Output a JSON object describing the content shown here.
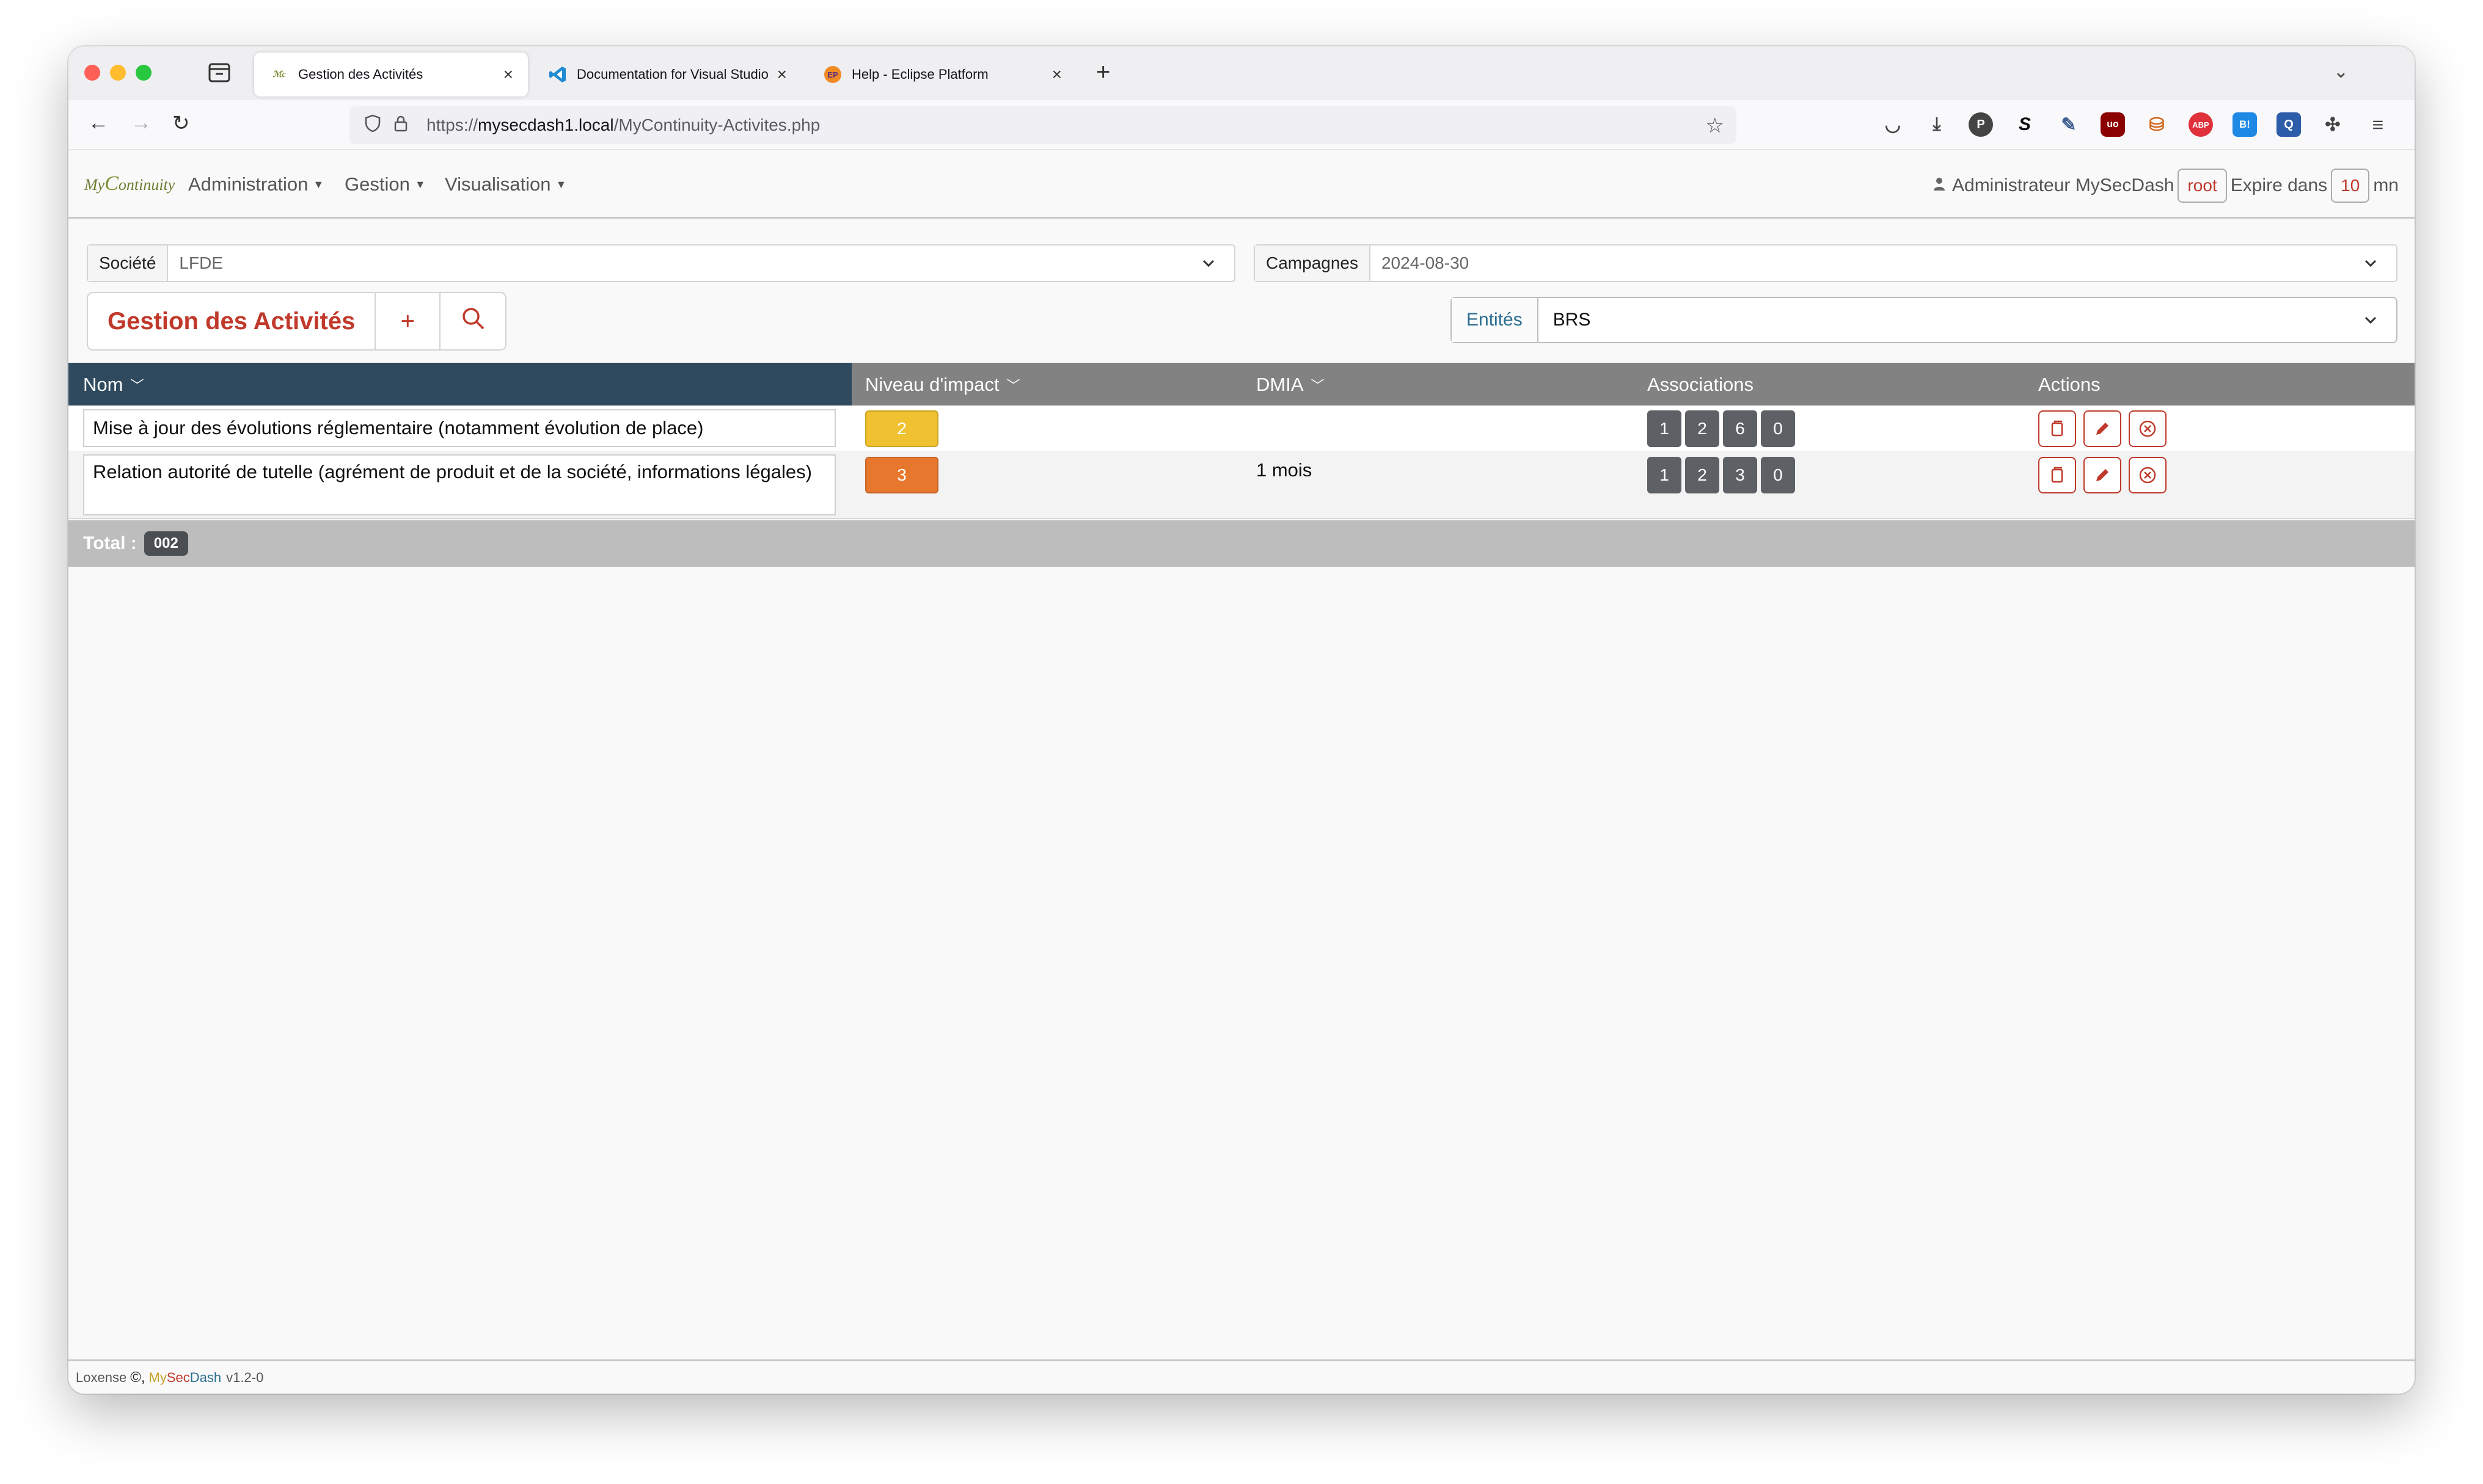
{
  "browser": {
    "tabs": [
      {
        "label": "Gestion des Activités",
        "active": true
      },
      {
        "label": "Documentation for Visual Studio Code",
        "active": false
      },
      {
        "label": "Help - Eclipse Platform",
        "active": false
      }
    ],
    "url_scheme": "https://",
    "url_host": "mysecdash1.local",
    "url_path": "/MyContinuity-Activites.php",
    "ext_p": "P",
    "ext_s": "S",
    "ext_abp": "ABP",
    "ext_b": "B!",
    "ext_q": "Q"
  },
  "app": {
    "logo_my": "My",
    "logo_c": "C",
    "logo_rest": "ontinuity",
    "menu": [
      "Administration",
      "Gestion",
      "Visualisation"
    ],
    "user_label": "Administrateur MySecDash",
    "user_login": "root",
    "expire_label": "Expire dans",
    "expire_value": "10",
    "expire_unit": "mn"
  },
  "filters": {
    "societe_label": "Société",
    "societe_value": "LFDE",
    "campagnes_label": "Campagnes",
    "campagnes_value": "2024-08-30",
    "entites_label": "Entités",
    "entites_value": "BRS"
  },
  "toolbar": {
    "title": "Gestion des Activités",
    "add": "+"
  },
  "table": {
    "headers": {
      "nom": "Nom",
      "niveau": "Niveau d'impact",
      "dmia": "DMIA",
      "associations": "Associations",
      "actions": "Actions"
    },
    "rows": [
      {
        "nom": "Mise à jour des évolutions réglementaire (notamment évolution de place)",
        "niveau": "2",
        "niveau_color": "#f0c130",
        "dmia": "",
        "associations": [
          "1",
          "2",
          "6",
          "0"
        ]
      },
      {
        "nom": "Relation autorité de tutelle (agrément de produit et de la société, informations légales)",
        "niveau": "3",
        "niveau_color": "#e8772e",
        "dmia": "1 mois",
        "associations": [
          "1",
          "2",
          "3",
          "0"
        ]
      }
    ],
    "total_label": "Total :",
    "total_value": "002"
  },
  "footer": {
    "company": "Loxense",
    "copyright": "©,",
    "brand_my": "My",
    "brand_sec": "Sec",
    "brand_dash": "Dash",
    "version": "v1.2-0"
  },
  "colors": {
    "accent": "#c0392b",
    "header_dark": "#2f4a5e",
    "header_grey": "#828282",
    "badge": "#5d6166"
  }
}
